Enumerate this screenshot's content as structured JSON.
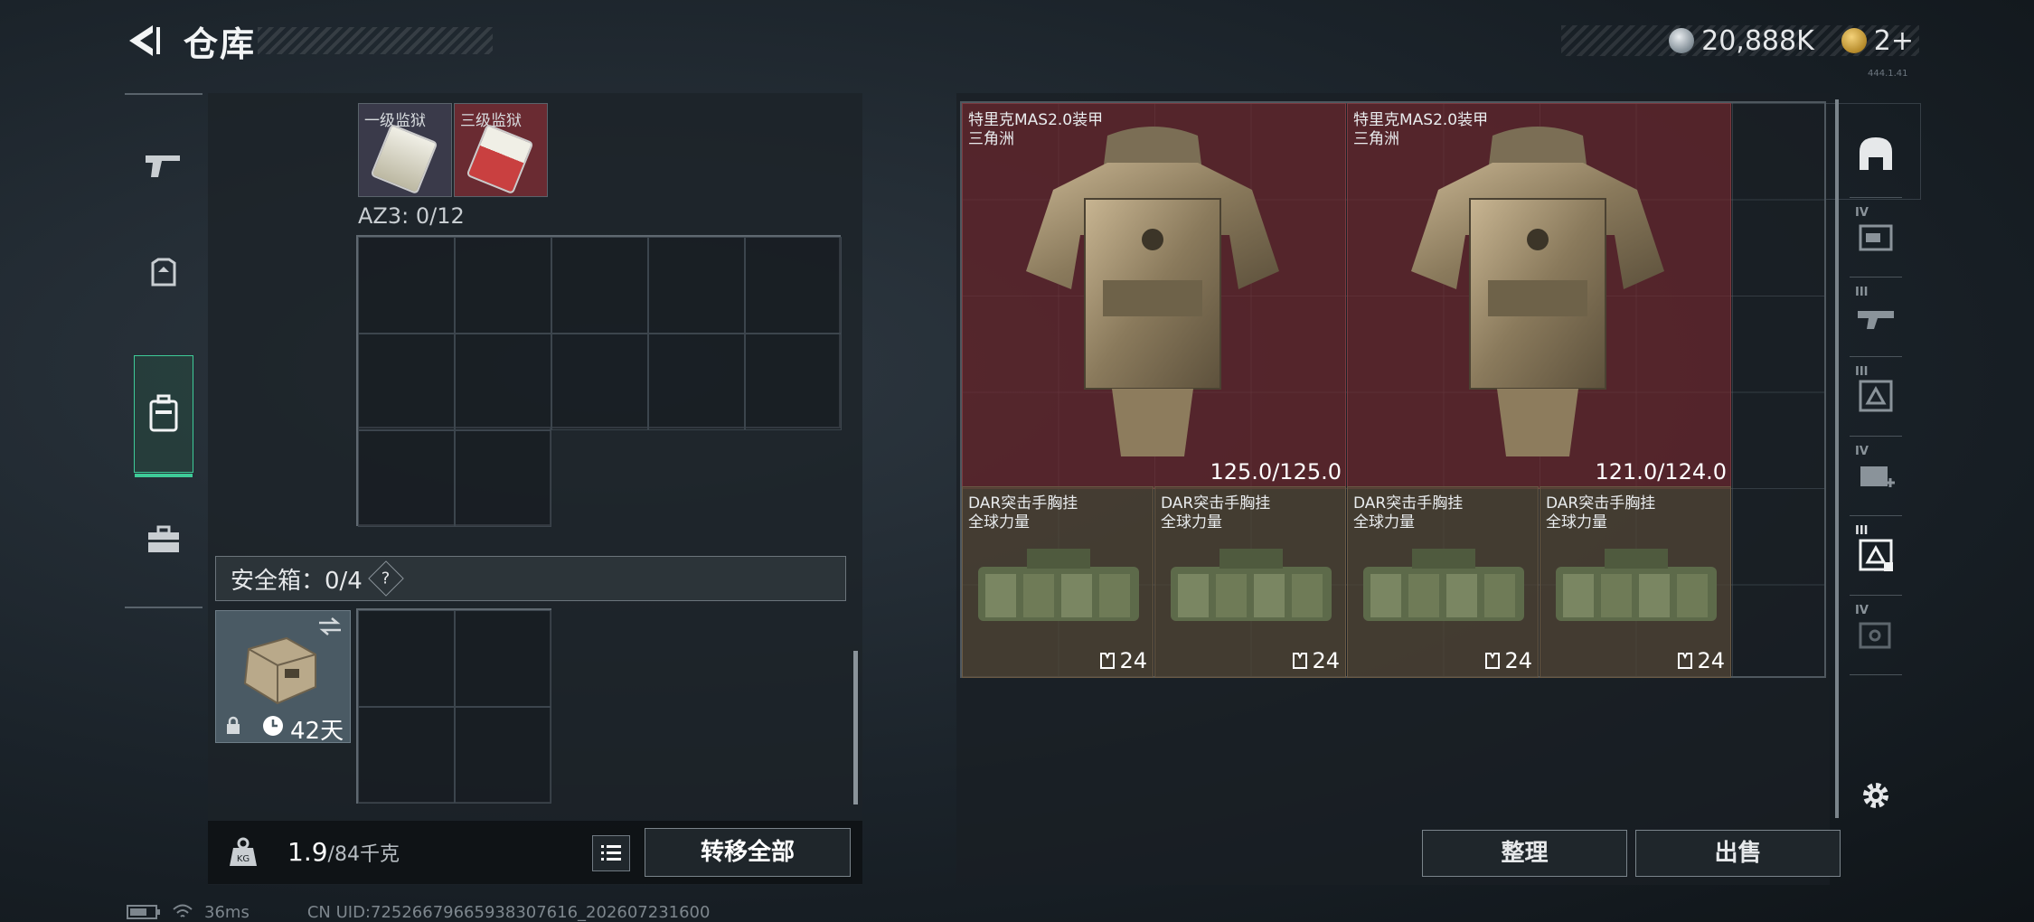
{
  "header": {
    "title": "仓库",
    "currency": {
      "coins": "20,888K",
      "tickets": "2+"
    },
    "version_tag": "444.1.41"
  },
  "left_rail": {
    "items": [
      {
        "id": "weapons",
        "icon": "pistol-icon"
      },
      {
        "id": "armor",
        "icon": "helmet-icon"
      },
      {
        "id": "backpack",
        "icon": "backpack-icon",
        "active": true
      },
      {
        "id": "supplies",
        "icon": "toolbox-icon"
      }
    ]
  },
  "storage": {
    "top_items": [
      {
        "name": "一级监狱",
        "color": "#d8d6c8"
      },
      {
        "name": "三级监狱",
        "color": "#c94040"
      }
    ],
    "az3_label": "AZ3: 0/12",
    "safebox_label": "安全箱：0/4",
    "help": "?",
    "safebox_duration": "42天",
    "weight_value": "1.9",
    "weight_capacity": "/84千克",
    "transfer_all": "转移全部"
  },
  "right_storage": {
    "armors": [
      {
        "name": "特里克MAS2.0装甲",
        "brand": "三角洲",
        "durability": "125.0/125.0"
      },
      {
        "name": "特里克MAS2.0装甲",
        "brand": "三角洲",
        "durability": "121.0/124.0"
      }
    ],
    "chest_rigs": [
      {
        "name": "DAR突击手胸挂",
        "brand": "全球力量",
        "capacity": "24"
      },
      {
        "name": "DAR突击手胸挂",
        "brand": "全球力量",
        "capacity": "24"
      },
      {
        "name": "DAR突击手胸挂",
        "brand": "全球力量",
        "capacity": "24"
      },
      {
        "name": "DAR突击手胸挂",
        "brand": "全球力量",
        "capacity": "24"
      }
    ],
    "sort_label": "整理",
    "sell_label": "出售"
  },
  "right_rail": {
    "filters": [
      {
        "tier": "",
        "icon": "helmet-filter-icon"
      },
      {
        "tier": "IV",
        "icon": "container-filter-icon"
      },
      {
        "tier": "III",
        "icon": "gun-filter-icon"
      },
      {
        "tier": "III",
        "icon": "armor-filter-icon"
      },
      {
        "tier": "IV",
        "icon": "medkit-filter-icon"
      },
      {
        "tier": "III",
        "icon": "vest-filter-icon"
      },
      {
        "tier": "IV",
        "icon": "backpack-filter-icon"
      }
    ]
  },
  "status": {
    "ping": "36ms",
    "uid": "CN UID:7252667966593830761​6_202607231600"
  },
  "colors": {
    "accent": "#3ecb98",
    "armor_bg": "#73282e",
    "rig_bg": "#524636"
  }
}
